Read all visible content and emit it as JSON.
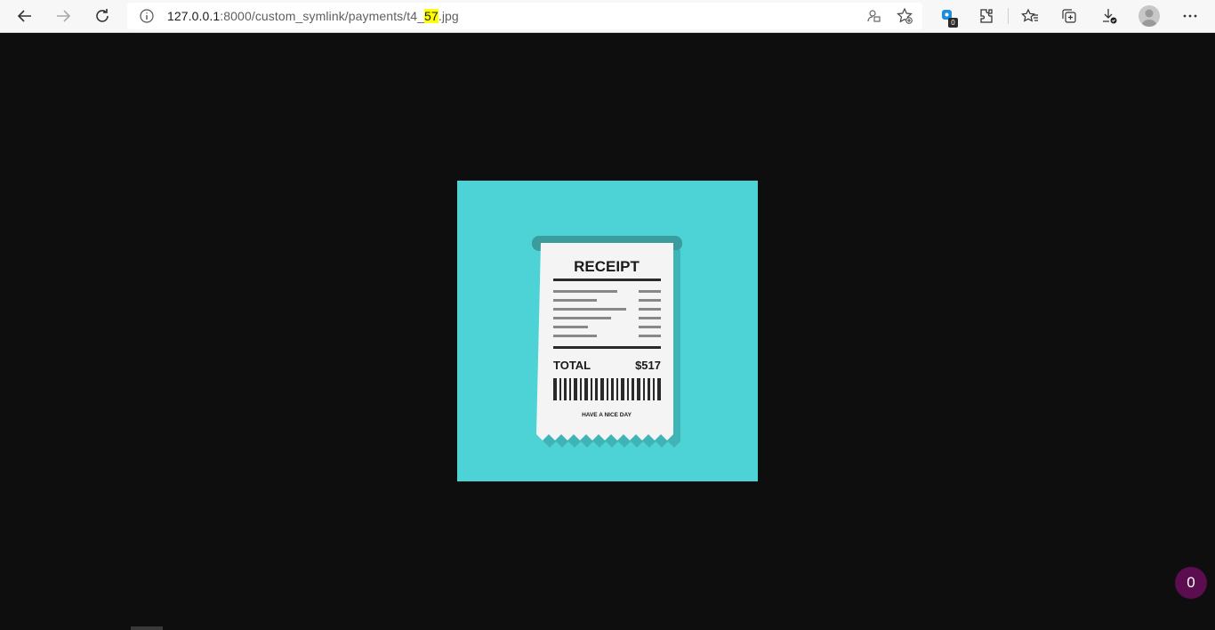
{
  "browser": {
    "url": {
      "host": "127.0.0.1",
      "path_before": ":8000/custom_symlink/payments/t4_",
      "highlight": "57",
      "path_after": ".jpg"
    },
    "extension_badge": "0",
    "icons": [
      "back-icon",
      "forward-icon",
      "refresh-icon",
      "info-icon",
      "user-sync-icon",
      "add-favorite-icon",
      "extension-badge-icon",
      "extensions-icon",
      "favorites-icon",
      "collections-icon",
      "downloads-icon",
      "profile-avatar",
      "more-menu-icon"
    ]
  },
  "receipt": {
    "title": "RECEIPT",
    "total_label": "TOTAL",
    "total_value": "$517",
    "footer": "HAVE A NICE DAY"
  },
  "colors": {
    "page_bg": "#0e0e0e",
    "image_bg": "#4dd3d6",
    "printer_bar": "#3a9c9c",
    "counter_bg": "#5b0d4f"
  },
  "counter": {
    "value": "0"
  }
}
